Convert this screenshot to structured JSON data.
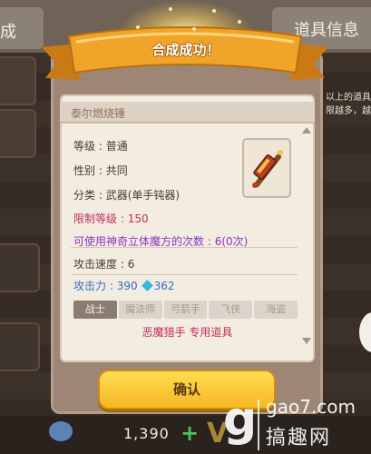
{
  "background": {
    "left_tab": "成",
    "right_tab": "道具信息",
    "side_text_1": "以上的道具",
    "side_text_2": "限越多，越",
    "currency_amount": "1,390",
    "plus_label": "+",
    "candy_icon": "candy-icon",
    "vip_label": "V"
  },
  "banner": {
    "title": "合成成功！"
  },
  "item": {
    "name": "泰尔燃烧锤",
    "icon": "hammer-icon",
    "stats": {
      "grade_label": "等级",
      "grade_value": "普通",
      "gender_label": "性别",
      "gender_value": "共同",
      "category_label": "分类",
      "category_value": "武器(单手钝器)",
      "level_req_label": "限制等级",
      "level_req_value": "150",
      "cube_label": "可使用神奇立体魔方的次数",
      "cube_value": "6(0次)",
      "attack_speed_label": "攻击速度",
      "attack_speed_value": "6",
      "attack_label": "攻击力",
      "attack_value": "390",
      "attack_bonus": "362",
      "separator": " : "
    },
    "classes": [
      {
        "label": "战士",
        "active": true
      },
      {
        "label": "魔法师",
        "active": false
      },
      {
        "label": "弓箭手",
        "active": false
      },
      {
        "label": "飞侠",
        "active": false
      },
      {
        "label": "海盗",
        "active": false
      }
    ],
    "exclusive_note": "恶魔猎手 专用道具"
  },
  "confirm_label": "确认",
  "watermark": {
    "glyph": "g",
    "url": "gao7.com",
    "name": "搞趣网"
  },
  "colors": {
    "red": "#c0305a",
    "purple": "#8b35c4",
    "blue": "#2f6fc8",
    "button": "#f4b823",
    "banner": "#f0a52a"
  }
}
